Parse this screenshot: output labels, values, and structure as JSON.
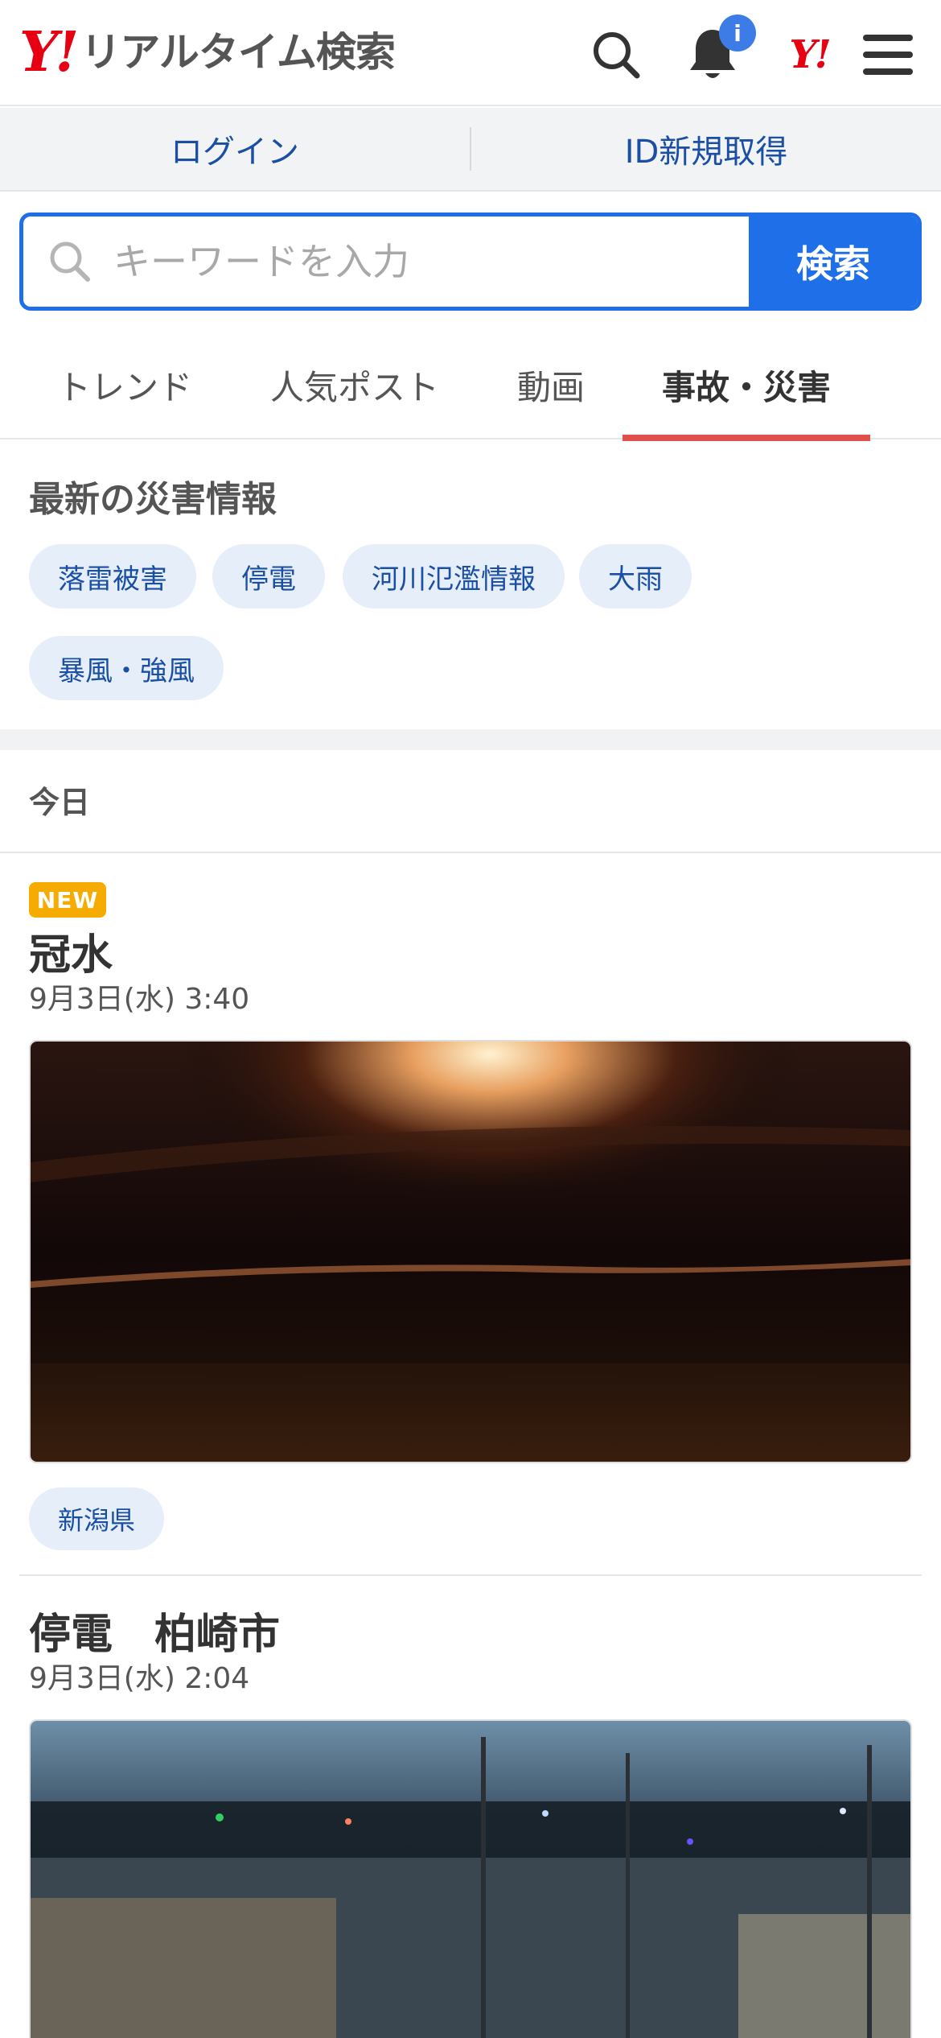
{
  "header": {
    "logo_mark": "Y!",
    "logo_text": "リアルタイム検索",
    "notification_badge": "i",
    "yahoo_mark": "Y!"
  },
  "login_bar": {
    "login": "ログイン",
    "signup": "ID新規取得"
  },
  "search": {
    "placeholder": "キーワードを入力",
    "button": "検索"
  },
  "tabs": [
    "トレンド",
    "人気ポスト",
    "動画",
    "事故・災害"
  ],
  "disaster": {
    "title": "最新の災害情報",
    "chips": [
      "落雷被害",
      "停電",
      "河川氾濫情報",
      "大雨",
      "暴風・強風"
    ]
  },
  "date_header": "今日",
  "posts": [
    {
      "badge": "NEW",
      "title": "冠水",
      "time": "9月3日(水) 3:40",
      "location": "新潟県"
    },
    {
      "title": "停電　柏崎市",
      "time": "9月3日(水) 2:04"
    }
  ],
  "colors": {
    "brand_red": "#e60012",
    "accent_blue": "#1e6fe8",
    "link_blue": "#1a4fa3",
    "tab_underline": "#e05050",
    "new_badge": "#f6ab00"
  }
}
